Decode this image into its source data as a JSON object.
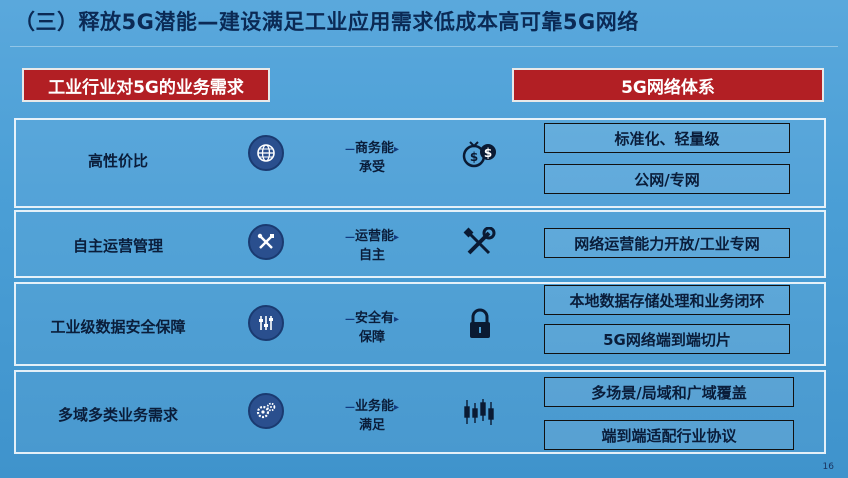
{
  "slide": {
    "title": "（三）释放5G潜能—建设满足工业应用需求低成本高可靠5G网络",
    "left_header": "工业行业对5G的业务需求",
    "right_header": "5G网络体系",
    "page_number": "16"
  },
  "rows": [
    {
      "label": "高性价比",
      "icon": "globe-icon",
      "capability": [
        "商务能",
        "承受"
      ],
      "right_icon": "coins-icon",
      "features": [
        "标准化、轻量级",
        "公网/专网"
      ]
    },
    {
      "label": "自主运营管理",
      "icon": "tools-icon",
      "capability": [
        "运营能",
        "自主"
      ],
      "right_icon": "wrench-screwdriver-icon",
      "features": [
        "网络运营能力开放/工业专网"
      ]
    },
    {
      "label": "工业级数据安全保障",
      "icon": "sliders-icon",
      "capability": [
        "安全有",
        "保障"
      ],
      "right_icon": "lock-icon",
      "features": [
        "本地数据存储处理和业务闭环",
        "5G网络端到端切片"
      ]
    },
    {
      "label": "多域多类业务需求",
      "icon": "gears-icon",
      "capability": [
        "业务能",
        "满足"
      ],
      "right_icon": "candlestick-icon",
      "features": [
        "多场景/局域和广域覆盖",
        "端到端适配行业协议"
      ]
    }
  ],
  "colors": {
    "background": "#4b9fd6",
    "banner": "#b21f24",
    "title": "#0b2a55",
    "icon_circle": "#2a4f8e"
  }
}
